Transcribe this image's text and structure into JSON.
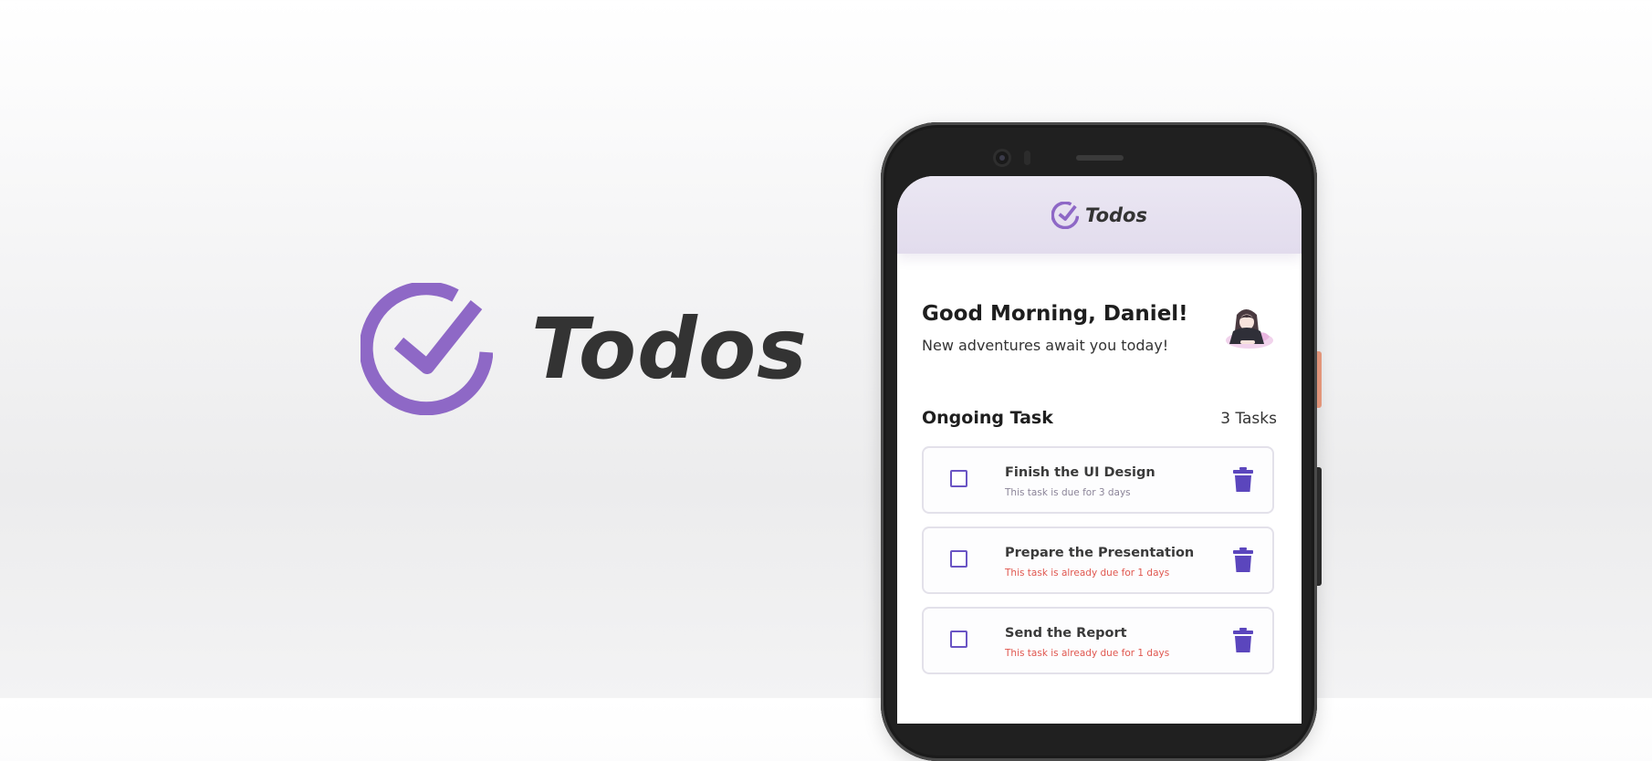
{
  "brand": {
    "name": "Todos",
    "logo_icon": "circle-check-icon",
    "accent_color": "#8e68c6"
  },
  "app": {
    "header": {
      "title": "Todos",
      "logo_icon": "circle-check-icon"
    },
    "greeting": "Good Morning, Daniel!",
    "subtitle": "New adventures await you today!",
    "avatar_icon": "anime-avatar",
    "section": {
      "title": "Ongoing Task",
      "count_label": "3 Tasks"
    },
    "tasks": [
      {
        "title": "Finish the UI Design",
        "due": "This task is due for 3 days",
        "overdue": false
      },
      {
        "title": "Prepare the Presentation",
        "due": "This task is already due for 1 days",
        "overdue": true
      },
      {
        "title": "Send the Report",
        "due": "This task is already due for 1 days",
        "overdue": true
      }
    ],
    "colors": {
      "checkbox": "#6a54c4",
      "trash": "#5b46bd",
      "overdue": "#e0574f"
    }
  }
}
